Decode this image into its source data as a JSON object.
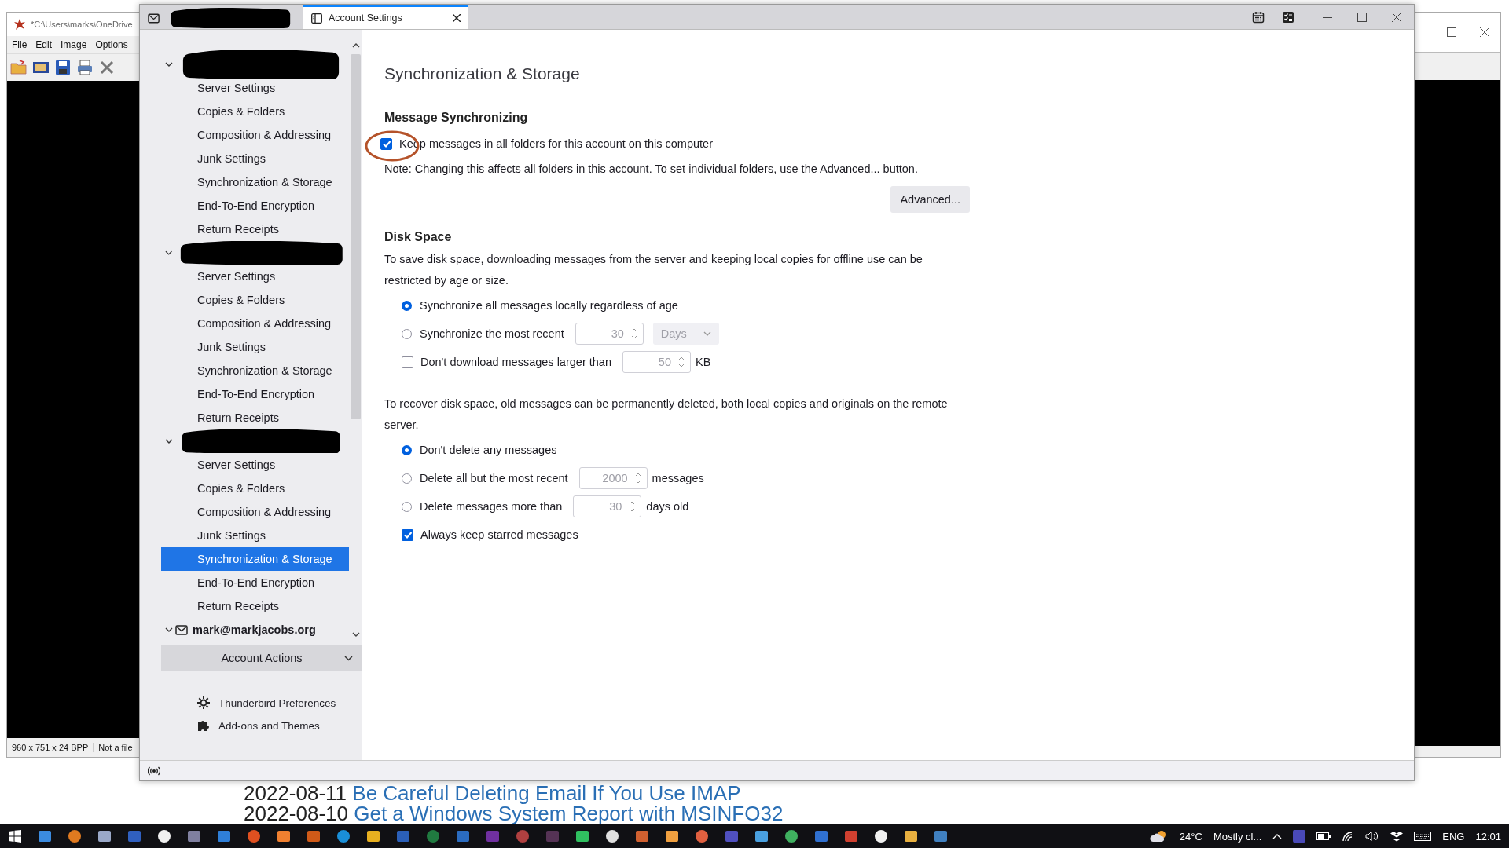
{
  "viewer_window": {
    "title": "*C:\\Users\\marks\\OneDrive",
    "menu": [
      "File",
      "Edit",
      "Image",
      "Options"
    ],
    "status": [
      "960 x 751 x 24 BPP",
      "Not a file"
    ]
  },
  "blog_posts": [
    {
      "date": "2022-08-11",
      "title": "Be Careful Deleting Email If You Use IMAP"
    },
    {
      "date": "2022-08-10",
      "title": "Get a Windows System Report with MSINFO32"
    }
  ],
  "tabs": [
    {
      "kind": "redacted",
      "selected": false
    },
    {
      "kind": "text",
      "label": "Account Settings",
      "selected": true
    }
  ],
  "accounts": [
    {
      "kind": "redacted",
      "expanded": true,
      "children": [
        {
          "label": "Server Settings",
          "selected": false
        },
        {
          "label": "Copies & Folders",
          "selected": false
        },
        {
          "label": "Composition & Addressing",
          "selected": false
        },
        {
          "label": "Junk Settings",
          "selected": false
        },
        {
          "label": "Synchronization & Storage",
          "selected": false
        },
        {
          "label": "End-To-End Encryption",
          "selected": false
        },
        {
          "label": "Return Receipts",
          "selected": false
        }
      ]
    },
    {
      "kind": "redacted",
      "expanded": true,
      "children": [
        {
          "label": "Server Settings",
          "selected": false
        },
        {
          "label": "Copies & Folders",
          "selected": false
        },
        {
          "label": "Composition & Addressing",
          "selected": false
        },
        {
          "label": "Junk Settings",
          "selected": false
        },
        {
          "label": "Synchronization & Storage",
          "selected": false
        },
        {
          "label": "End-To-End Encryption",
          "selected": false
        },
        {
          "label": "Return Receipts",
          "selected": false
        }
      ]
    },
    {
      "kind": "redacted",
      "expanded": true,
      "children": [
        {
          "label": "Server Settings",
          "selected": false
        },
        {
          "label": "Copies & Folders",
          "selected": false
        },
        {
          "label": "Composition & Addressing",
          "selected": false
        },
        {
          "label": "Junk Settings",
          "selected": false
        },
        {
          "label": "Synchronization & Storage",
          "selected": true
        },
        {
          "label": "End-To-End Encryption",
          "selected": false
        },
        {
          "label": "Return Receipts",
          "selected": false
        }
      ]
    },
    {
      "kind": "named",
      "label": "mark@markjacobs.org",
      "expanded": true
    }
  ],
  "account_actions": "Account Actions",
  "footer_links": [
    {
      "kind": "preferences",
      "label": "Thunderbird Preferences"
    },
    {
      "kind": "addons",
      "label": "Add-ons and Themes"
    }
  ],
  "page_title": "Synchronization & Storage",
  "message_sync": {
    "heading": "Message Synchronizing",
    "keep_messages": {
      "label": "Keep messages in all folders for this account on this computer",
      "checked": true
    },
    "note": "Note: Changing this affects all folders in this account. To set individual folders, use the Advanced... button.",
    "advanced_button": "Advanced..."
  },
  "disk_space": {
    "heading": "Disk Space",
    "intro": "To save disk space, downloading messages from the server and keeping local copies for offline use can be restricted by age or size.",
    "options": [
      {
        "kind": "radio",
        "label": "Synchronize all messages locally regardless of age",
        "selected": true
      },
      {
        "kind": "radio",
        "label": "Synchronize the most recent",
        "selected": false,
        "spinner": {
          "value": "30",
          "disabled": true
        },
        "unit_select": {
          "value": "Days",
          "disabled": true
        }
      },
      {
        "kind": "checkbox",
        "label": "Don't download messages larger than",
        "checked": false,
        "spinner": {
          "value": "50",
          "disabled": true
        },
        "suffix": "KB"
      }
    ],
    "recover_intro": "To recover disk space, old messages can be permanently deleted, both local copies and originals on the remote server.",
    "delete_options": [
      {
        "kind": "radio",
        "label": "Don't delete any messages",
        "selected": true
      },
      {
        "kind": "radio",
        "label": "Delete all but the most recent",
        "selected": false,
        "spinner": {
          "value": "2000",
          "disabled": true
        },
        "suffix": "messages"
      },
      {
        "kind": "radio",
        "label": "Delete messages more than",
        "selected": false,
        "spinner": {
          "value": "30",
          "disabled": true
        },
        "suffix": "days old"
      },
      {
        "kind": "checkbox",
        "label": "Always keep starred messages",
        "checked": true
      }
    ]
  },
  "taskbar": {
    "temperature": "24°C",
    "weather": "Mostly cl...",
    "language": "ENG",
    "time": "12:01"
  }
}
